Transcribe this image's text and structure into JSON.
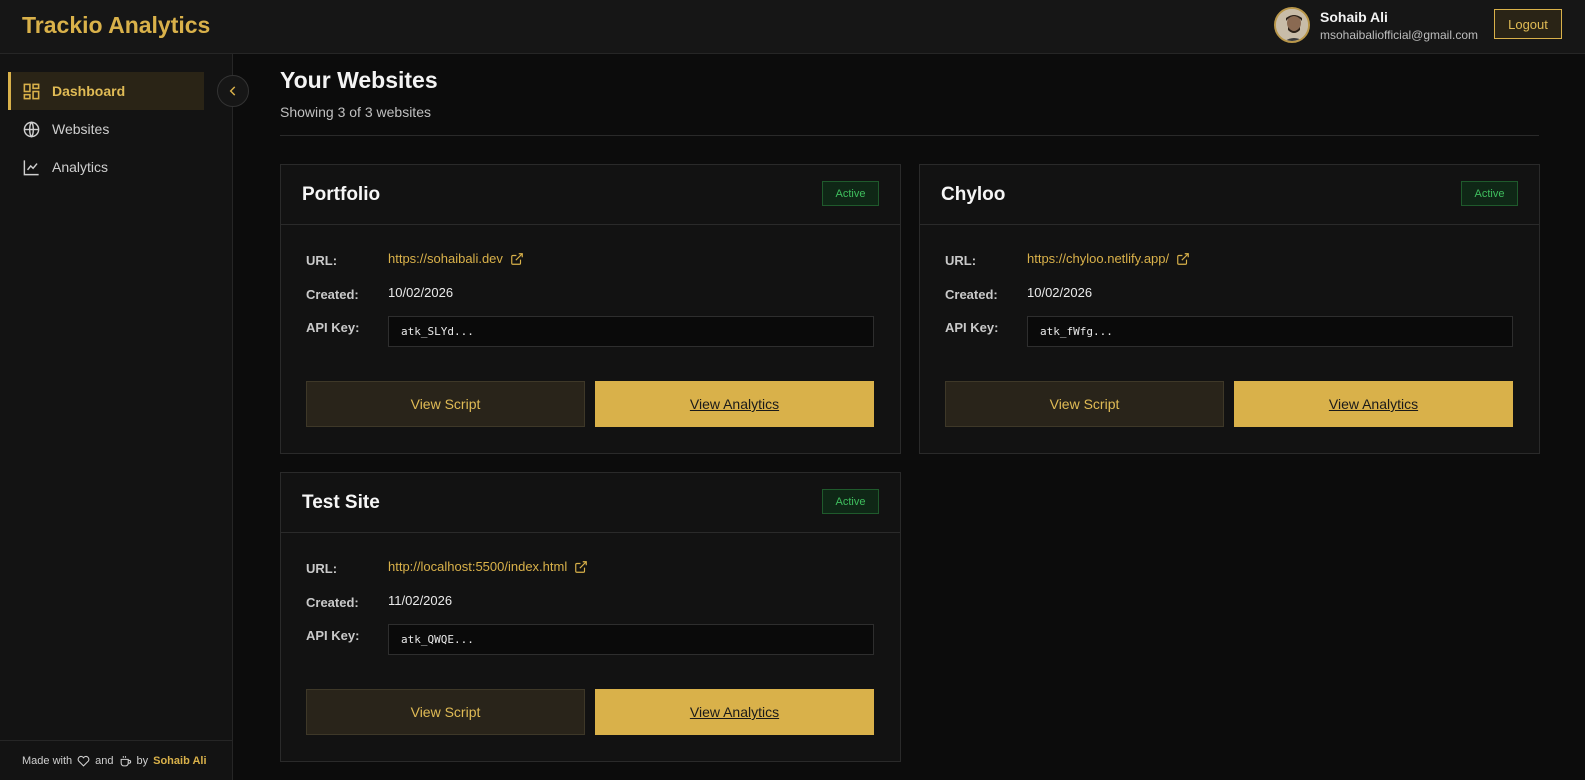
{
  "app": {
    "brand": "Trackio Analytics"
  },
  "user": {
    "name": "Sohaib Ali",
    "email": "msohaibaliofficial@gmail.com",
    "logout_label": "Logout"
  },
  "sidebar": {
    "items": [
      {
        "label": "Dashboard",
        "icon": "dashboard-grid-icon",
        "active": true
      },
      {
        "label": "Websites",
        "icon": "globe-icon",
        "active": false
      },
      {
        "label": "Analytics",
        "icon": "line-chart-icon",
        "active": false
      }
    ],
    "footer": {
      "made_with": "Made with",
      "and": "and",
      "by": "by",
      "author": "Sohaib Ali"
    }
  },
  "main": {
    "title": "Your Websites",
    "subtitle": "Showing 3 of 3 websites",
    "labels": {
      "url": "URL:",
      "created": "Created:",
      "api_key": "API Key:"
    },
    "cards": [
      {
        "name": "Portfolio",
        "status": "Active",
        "url": "https://sohaibali.dev",
        "created": "10/02/2026",
        "api_key": "atk_SLYd...",
        "script_label": "View Script",
        "analytics_label": "View Analytics"
      },
      {
        "name": "Chyloo",
        "status": "Active",
        "url": "https://chyloo.netlify.app/",
        "created": "10/02/2026",
        "api_key": "atk_fWfg...",
        "script_label": "View Script",
        "analytics_label": "View Analytics"
      },
      {
        "name": "Test Site",
        "status": "Active",
        "url": "http://localhost:5500/index.html",
        "created": "11/02/2026",
        "api_key": "atk_QWQE...",
        "script_label": "View Script",
        "analytics_label": "View Analytics"
      }
    ]
  },
  "colors": {
    "accent": "#d9b14a",
    "background": "#0c0c0c",
    "active_badge": "#3fbf5e"
  }
}
